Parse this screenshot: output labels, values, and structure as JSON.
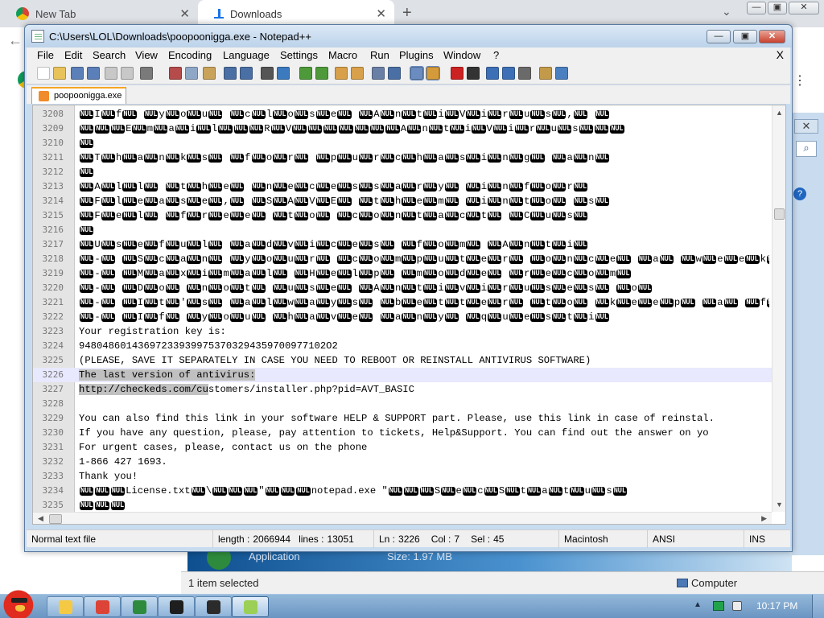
{
  "chrome": {
    "tabs": [
      {
        "label": "New Tab"
      },
      {
        "label": "Downloads"
      }
    ],
    "new_tab_symbol": "+",
    "close_symbol": "✕",
    "overflow_symbol": "⌄",
    "back_symbol": "←",
    "menu_symbol": "⋮",
    "win_min": "—",
    "win_max": "▣",
    "win_close": "✕"
  },
  "explorer": {
    "close_symbol": "✕",
    "search_symbol": "⌕",
    "help_symbol": "?",
    "app_label": "Application",
    "size_label": "Size: 1.97 MB",
    "selected_text": "1 item selected",
    "computer_text": "Computer"
  },
  "npp": {
    "title": "C:\\Users\\LOL\\Downloads\\poopoonigga.exe - Notepad++",
    "min_symbol": "—",
    "max_symbol": "▣",
    "close_symbol": "✕",
    "menus": [
      "File",
      "Edit",
      "Search",
      "View",
      "Encoding",
      "Language",
      "Settings",
      "Macro",
      "Run",
      "Plugins",
      "Window",
      "?"
    ],
    "menu_close": "X",
    "toolbar_icons": [
      {
        "name": "new-file-icon",
        "color": "#ffffff"
      },
      {
        "name": "open-file-icon",
        "color": "#e8c35a"
      },
      {
        "name": "save-icon",
        "color": "#5b7fb8"
      },
      {
        "name": "save-all-icon",
        "color": "#5b7fb8"
      },
      {
        "name": "close-icon",
        "color": "#c8c8c8"
      },
      {
        "name": "close-all-icon",
        "color": "#c8c8c8"
      },
      {
        "name": "print-icon",
        "color": "#7a7a7a"
      },
      {
        "name": "cut-icon",
        "color": "#b54b4b"
      },
      {
        "name": "copy-icon",
        "color": "#8fa7c7"
      },
      {
        "name": "paste-icon",
        "color": "#c9a35a"
      },
      {
        "name": "undo-icon",
        "color": "#4a6fa5"
      },
      {
        "name": "redo-icon",
        "color": "#4a6fa5"
      },
      {
        "name": "find-icon",
        "color": "#555555"
      },
      {
        "name": "replace-icon",
        "color": "#3c7abf"
      },
      {
        "name": "zoom-in-icon",
        "color": "#4e9a3a"
      },
      {
        "name": "zoom-out-icon",
        "color": "#4e9a3a"
      },
      {
        "name": "sync-vertical-icon",
        "color": "#d8a04a"
      },
      {
        "name": "sync-horizontal-icon",
        "color": "#d8a04a"
      },
      {
        "name": "word-wrap-icon",
        "color": "#6a7fa5"
      },
      {
        "name": "show-all-chars-icon",
        "color": "#4a6fa5"
      },
      {
        "name": "indent-guide-icon",
        "color": "#6a8cc0"
      },
      {
        "name": "user-defined-lang-icon",
        "color": "#d59b3b"
      },
      {
        "name": "record-macro-icon",
        "color": "#cc2222"
      },
      {
        "name": "stop-record-icon",
        "color": "#333333"
      },
      {
        "name": "play-macro-icon",
        "color": "#3d6fb6"
      },
      {
        "name": "play-multiple-icon",
        "color": "#3d6fb6"
      },
      {
        "name": "save-macro-icon",
        "color": "#6a6a6a"
      },
      {
        "name": "doc-map-icon",
        "color": "#c29a4a"
      },
      {
        "name": "spell-check-icon",
        "color": "#4a7fc0"
      }
    ],
    "doc_tab": "poopoonigga.exe",
    "lines": [
      {
        "n": "3208",
        "t": "⓪I⓪f⓪ ⓪y⓪o⓪u⓪ ⓪c⓪l⓪o⓪s⓪e⓪ ⓪A⓪n⓪t⓪i⓪V⓪i⓪r⓪u⓪s⓪,⓪ ⓪"
      },
      {
        "n": "3209",
        "t": "⓪⓪⓪E⓪m⓪a⓪i⓪l⓪⓪⓪R⓪V⓪⓪⓪⓪⓪⓪⓪A⓪n⓪t⓪i⓪V⓪i⓪r⓪u⓪s⓪⓪⓪"
      },
      {
        "n": "3210",
        "t": "⓪"
      },
      {
        "n": "3211",
        "t": "⓪T⓪h⓪a⓪n⓪k⓪s⓪ ⓪f⓪o⓪r⓪ ⓪p⓪u⓪r⓪c⓪h⓪a⓪s⓪i⓪n⓪g⓪ ⓪a⓪n⓪"
      },
      {
        "n": "3212",
        "t": "⓪"
      },
      {
        "n": "3213",
        "t": "⓪A⓪l⓪l⓪ ⓪t⓪h⓪e⓪ ⓪n⓪e⓪c⓪e⓪s⓪s⓪a⓪r⓪y⓪ ⓪i⓪n⓪f⓪o⓪r⓪"
      },
      {
        "n": "3214",
        "t": "⓪F⓪l⓪e⓪a⓪s⓪e⓪,⓪ ⓪S⓪A⓪V⓪E⓪ ⓪t⓪h⓪e⓪m⓪ ⓪i⓪n⓪t⓪o⓪ ⓪s⓪"
      },
      {
        "n": "3215",
        "t": "⓪F⓪e⓪l⓪ ⓪f⓪r⓪e⓪e⓪ ⓪t⓪o⓪ ⓪c⓪o⓪n⓪t⓪a⓪c⓪t⓪ ⓪C⓪u⓪s⓪"
      },
      {
        "n": "3216",
        "t": "⓪"
      },
      {
        "n": "3217",
        "t": "⓪U⓪s⓪e⓪f⓪u⓪l⓪ ⓪a⓪d⓪v⓪i⓪c⓪e⓪s⓪ ⓪f⓪o⓪m⓪ ⓪A⓪n⓪t⓪i⓪"
      },
      {
        "n": "3218",
        "t": "⓪-⓪ ⓪S⓪c⓪a⓪n⓪ ⓪y⓪o⓪u⓪r⓪ ⓪c⓪o⓪m⓪p⓪u⓪t⓪e⓪r⓪ ⓪o⓪n⓪c⓪e⓪ ⓪a⓪ ⓪w⓪e⓪e⓪k⓪"
      },
      {
        "n": "3219",
        "t": "⓪-⓪ ⓪M⓪a⓪x⓪i⓪m⓪a⓪l⓪ ⓪H⓪e⓪l⓪p⓪ ⓪m⓪o⓪d⓪e⓪ ⓪r⓪e⓪c⓪o⓪m⓪"
      },
      {
        "n": "3220",
        "t": "⓪-⓪ ⓪D⓪o⓪ ⓪n⓪o⓪t⓪ ⓪u⓪s⓪e⓪ ⓪A⓪n⓪t⓪i⓪v⓪i⓪r⓪u⓪s⓪e⓪s⓪ ⓪o⓪"
      },
      {
        "n": "3221",
        "t": "⓪-⓪ ⓪I⓪t⓪'⓪s⓪ ⓪a⓪l⓪w⓪a⓪y⓪s⓪ ⓪b⓪e⓪t⓪t⓪e⓪r⓪ ⓪t⓪o⓪ ⓪k⓪e⓪e⓪p⓪ ⓪a⓪ ⓪f⓪"
      },
      {
        "n": "3222",
        "t": "⓪-⓪ ⓪I⓪f⓪ ⓪y⓪o⓪u⓪ ⓪h⓪a⓪v⓪e⓪ ⓪a⓪n⓪y⓪ ⓪q⓪u⓪e⓪s⓪t⓪i⓪"
      },
      {
        "n": "3223",
        "t": "Your registration key is:"
      },
      {
        "n": "3224",
        "t": "948048601436972339399753703294359700977102O2"
      },
      {
        "n": "3225",
        "t": "(PLEASE, SAVE IT SEPARATELY IN CASE YOU NEED TO REBOOT OR REINSTALL ANTIVIRUS SOFTWARE)"
      },
      {
        "n": "3226",
        "t": "The last version of antivirus:"
      },
      {
        "n": "3227",
        "t": "http://checkeds.com/customers/installer.php?pid=AVT_BASIC"
      },
      {
        "n": "3228",
        "t": ""
      },
      {
        "n": "3229",
        "t": "You can also find this link in your software HELP & SUPPORT part. Please, use this link in case of reinstal."
      },
      {
        "n": "3230",
        "t": "If you have any question, please, pay attention to tickets, Help&Support. You can find out the answer on yo"
      },
      {
        "n": "3231",
        "t": "For urgent cases, please, contact us on the phone"
      },
      {
        "n": "3232",
        "t": "1-866 427 1693."
      },
      {
        "n": "3233",
        "t": "Thank you!"
      },
      {
        "n": "3234",
        "t": "⓪⓪⓪License.txt⓪\\⓪⓪⓪\"⓪⓪⓪notepad.exe \"⓪⓪⓪S⓪e⓪c⓪S⓪t⓪a⓪t⓪u⓪s⓪"
      },
      {
        "n": "3235",
        "t": "⓪⓪⓪"
      }
    ],
    "nul_label": "NUL",
    "scroll_up": "▲",
    "scroll_down": "▼",
    "scroll_left": "◀",
    "scroll_right": "▶",
    "status": {
      "file_type": "Normal text file",
      "length_label": "length :",
      "length": "2066944",
      "lines_label": "lines :",
      "lines_count": "13051",
      "ln_label": "Ln :",
      "ln": "3226",
      "col_label": "Col :",
      "col": "7",
      "sel_label": "Sel :",
      "sel": "45",
      "eol": "Macintosh",
      "encoding": "ANSI",
      "ins": "INS"
    }
  },
  "taskbar": {
    "apps": [
      {
        "name": "windows-explorer-icon",
        "color": "#f5c944"
      },
      {
        "name": "chrome-icon",
        "color": "#db4437"
      },
      {
        "name": "antivirus-shield-icon",
        "color": "#2e8b3d"
      },
      {
        "name": "cmd-icon",
        "color": "#1e1e1e"
      },
      {
        "name": "7zip-icon",
        "color": "#2b2b2b"
      },
      {
        "name": "notepadpp-icon",
        "color": "#9ccf55"
      }
    ],
    "tray_arrow": "▲",
    "clock": "10:17 PM"
  }
}
